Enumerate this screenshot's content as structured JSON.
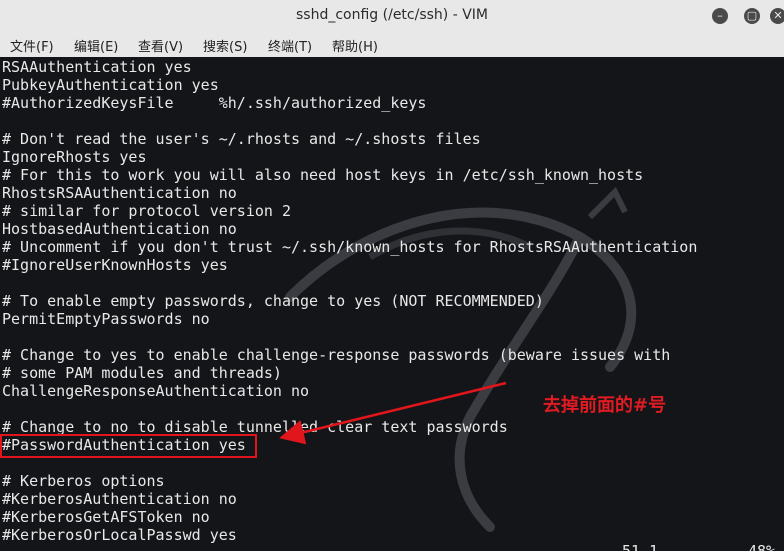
{
  "window": {
    "title": "sshd_config (/etc/ssh) - VIM",
    "buttons": {
      "minimize": "minimize-icon",
      "maximize": "maximize-icon",
      "close": "close-icon"
    }
  },
  "menu": [
    {
      "label": "文件(F)"
    },
    {
      "label": "编辑(E)"
    },
    {
      "label": "查看(V)"
    },
    {
      "label": "搜索(S)"
    },
    {
      "label": "终端(T)"
    },
    {
      "label": "帮助(H)"
    }
  ],
  "editor": {
    "lines": [
      "RSAAuthentication yes",
      "PubkeyAuthentication yes",
      "#AuthorizedKeysFile     %h/.ssh/authorized_keys",
      "",
      "# Don't read the user's ~/.rhosts and ~/.shosts files",
      "IgnoreRhosts yes",
      "# For this to work you will also need host keys in /etc/ssh_known_hosts",
      "RhostsRSAAuthentication no",
      "# similar for protocol version 2",
      "HostbasedAuthentication no",
      "# Uncomment if you don't trust ~/.ssh/known_hosts for RhostsRSAAuthentication",
      "#IgnoreUserKnownHosts yes",
      "",
      "# To enable empty passwords, change to yes (NOT RECOMMENDED)",
      "PermitEmptyPasswords no",
      "",
      "# Change to yes to enable challenge-response passwords (beware issues with",
      "# some PAM modules and threads)",
      "ChallengeResponseAuthentication no",
      "",
      "# Change to no to disable tunnelled clear text passwords",
      "#PasswordAuthentication yes",
      "",
      "# Kerberos options",
      "#KerberosAuthentication no",
      "#KerberosGetAFSToken no",
      "#KerberosOrLocalPasswd yes"
    ],
    "cursor_position": "51,1",
    "scroll_percent": "48%"
  },
  "annotation": {
    "text": "去掉前面的#号",
    "color": "#e21b22"
  },
  "colors": {
    "terminal_bg": "#141518",
    "text": "#e8e8e8",
    "highlight": "#e0161c"
  }
}
